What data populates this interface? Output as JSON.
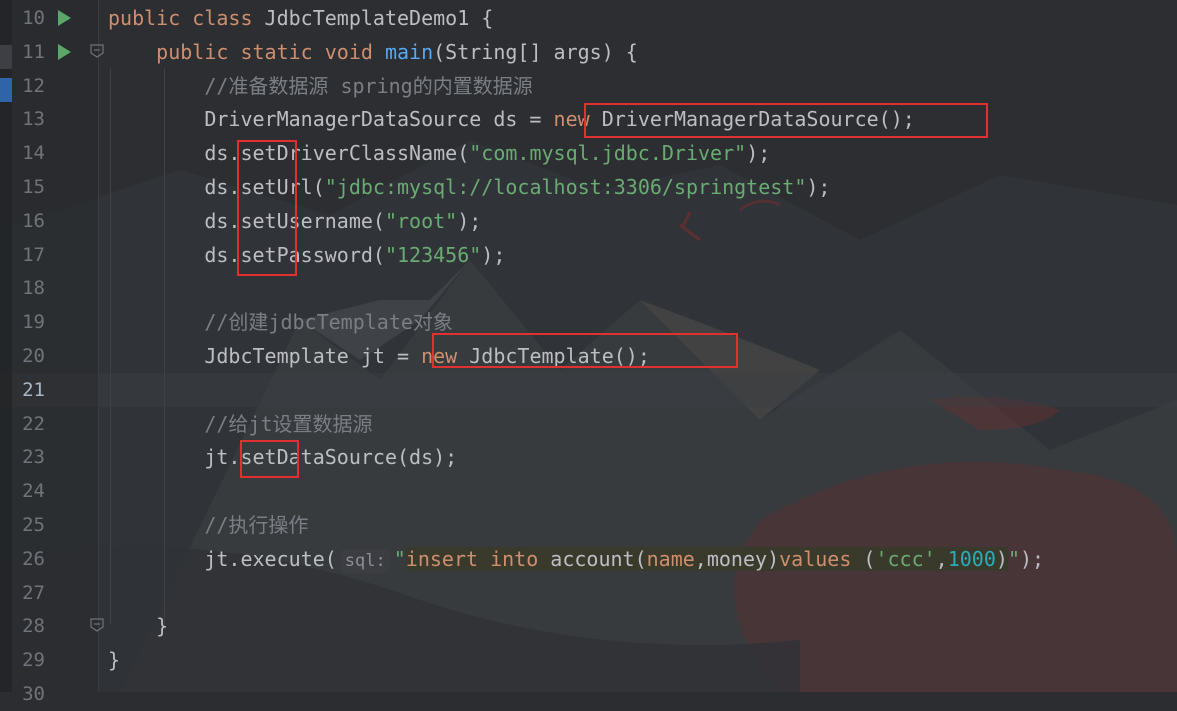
{
  "editor": {
    "lines": [
      {
        "n": "10",
        "tokens": [
          {
            "t": "public ",
            "c": "kw"
          },
          {
            "t": "class ",
            "c": "kw"
          },
          {
            "t": "JdbcTemplateDemo1 ",
            "c": "plain"
          },
          {
            "t": "{",
            "c": "plain"
          }
        ]
      },
      {
        "n": "11",
        "tokens": [
          {
            "t": "    public ",
            "c": "kw"
          },
          {
            "t": "static ",
            "c": "kw"
          },
          {
            "t": "void ",
            "c": "kw"
          },
          {
            "t": "main",
            "c": "fn"
          },
          {
            "t": "(String[] args) {",
            "c": "plain"
          }
        ]
      },
      {
        "n": "12",
        "tokens": [
          {
            "t": "        //准备数据源 spring的内置数据源",
            "c": "cmt"
          }
        ]
      },
      {
        "n": "13",
        "tokens": [
          {
            "t": "        DriverManagerDataSource ds = ",
            "c": "plain"
          },
          {
            "t": "new ",
            "c": "kw"
          },
          {
            "t": "DriverManagerDataSource();",
            "c": "plain"
          }
        ]
      },
      {
        "n": "14",
        "tokens": [
          {
            "t": "        ds.setDriverClassName(",
            "c": "plain"
          },
          {
            "t": "\"com.mysql.jdbc.Driver\"",
            "c": "str"
          },
          {
            "t": ");",
            "c": "plain"
          }
        ]
      },
      {
        "n": "15",
        "tokens": [
          {
            "t": "        ds.setUrl(",
            "c": "plain"
          },
          {
            "t": "\"jdbc:mysql://localhost:3306/springtest\"",
            "c": "str"
          },
          {
            "t": ");",
            "c": "plain"
          }
        ]
      },
      {
        "n": "16",
        "tokens": [
          {
            "t": "        ds.setUsername(",
            "c": "plain"
          },
          {
            "t": "\"root\"",
            "c": "str"
          },
          {
            "t": ");",
            "c": "plain"
          }
        ]
      },
      {
        "n": "17",
        "tokens": [
          {
            "t": "        ds.setPassword(",
            "c": "plain"
          },
          {
            "t": "\"123456\"",
            "c": "str"
          },
          {
            "t": ");",
            "c": "plain"
          }
        ]
      },
      {
        "n": "18",
        "tokens": []
      },
      {
        "n": "19",
        "tokens": [
          {
            "t": "        //创建jdbcTemplate对象",
            "c": "cmt"
          }
        ]
      },
      {
        "n": "20",
        "tokens": [
          {
            "t": "        JdbcTemplate jt = ",
            "c": "plain"
          },
          {
            "t": "new ",
            "c": "kw"
          },
          {
            "t": "JdbcTemplate();",
            "c": "plain"
          }
        ]
      },
      {
        "n": "21",
        "tokens": []
      },
      {
        "n": "22",
        "tokens": [
          {
            "t": "        //给jt设置数据源",
            "c": "cmt"
          }
        ]
      },
      {
        "n": "23",
        "tokens": [
          {
            "t": "        jt.setDataSource(ds);",
            "c": "plain"
          }
        ]
      },
      {
        "n": "24",
        "tokens": []
      },
      {
        "n": "25",
        "tokens": [
          {
            "t": "        //执行操作",
            "c": "cmt"
          }
        ]
      },
      {
        "n": "26",
        "tokens": [
          {
            "t": "        jt.execute(",
            "c": "plain"
          },
          {
            "t": "sql:",
            "c": "hint"
          },
          {
            "t": "\"",
            "c": "str"
          },
          {
            "t": "insert ",
            "c": "sqlkw sqlbg"
          },
          {
            "t": "into ",
            "c": "sqlkw sqlbg"
          },
          {
            "t": "account(",
            "c": "plain sqlbg"
          },
          {
            "t": "name",
            "c": "sqlkw sqlbg"
          },
          {
            "t": ",",
            "c": "plain sqlbg"
          },
          {
            "t": "money",
            "c": "plain sqlbg"
          },
          {
            "t": ")",
            "c": "plain sqlbg"
          },
          {
            "t": "values ",
            "c": "sqlkw sqlbg"
          },
          {
            "t": "(",
            "c": "plain sqlbg"
          },
          {
            "t": "'ccc'",
            "c": "str sqlbg"
          },
          {
            "t": ",",
            "c": "plain sqlbg"
          },
          {
            "t": "1000",
            "c": "num sqlbg"
          },
          {
            "t": ")",
            "c": "plain sqlbg"
          },
          {
            "t": "\"",
            "c": "str"
          },
          {
            "t": ");",
            "c": "plain"
          }
        ]
      },
      {
        "n": "27",
        "tokens": []
      },
      {
        "n": "28",
        "tokens": [
          {
            "t": "    }",
            "c": "plain"
          }
        ]
      },
      {
        "n": "29",
        "tokens": [
          {
            "t": "}",
            "c": "plain"
          }
        ]
      },
      {
        "n": "30",
        "tokens": []
      }
    ],
    "current_line": "21",
    "run_lines": [
      "10",
      "11"
    ],
    "fold_lines": [
      "11",
      "28"
    ]
  },
  "colors": {
    "keyword": "#cf8e6d",
    "string": "#6aab73",
    "comment": "#7a7e85",
    "text": "#bcbec4",
    "number": "#2aacb8",
    "highlight_box": "#e03030"
  },
  "icons": {
    "run": "run-gutter-icon",
    "fold": "fold-icon"
  }
}
